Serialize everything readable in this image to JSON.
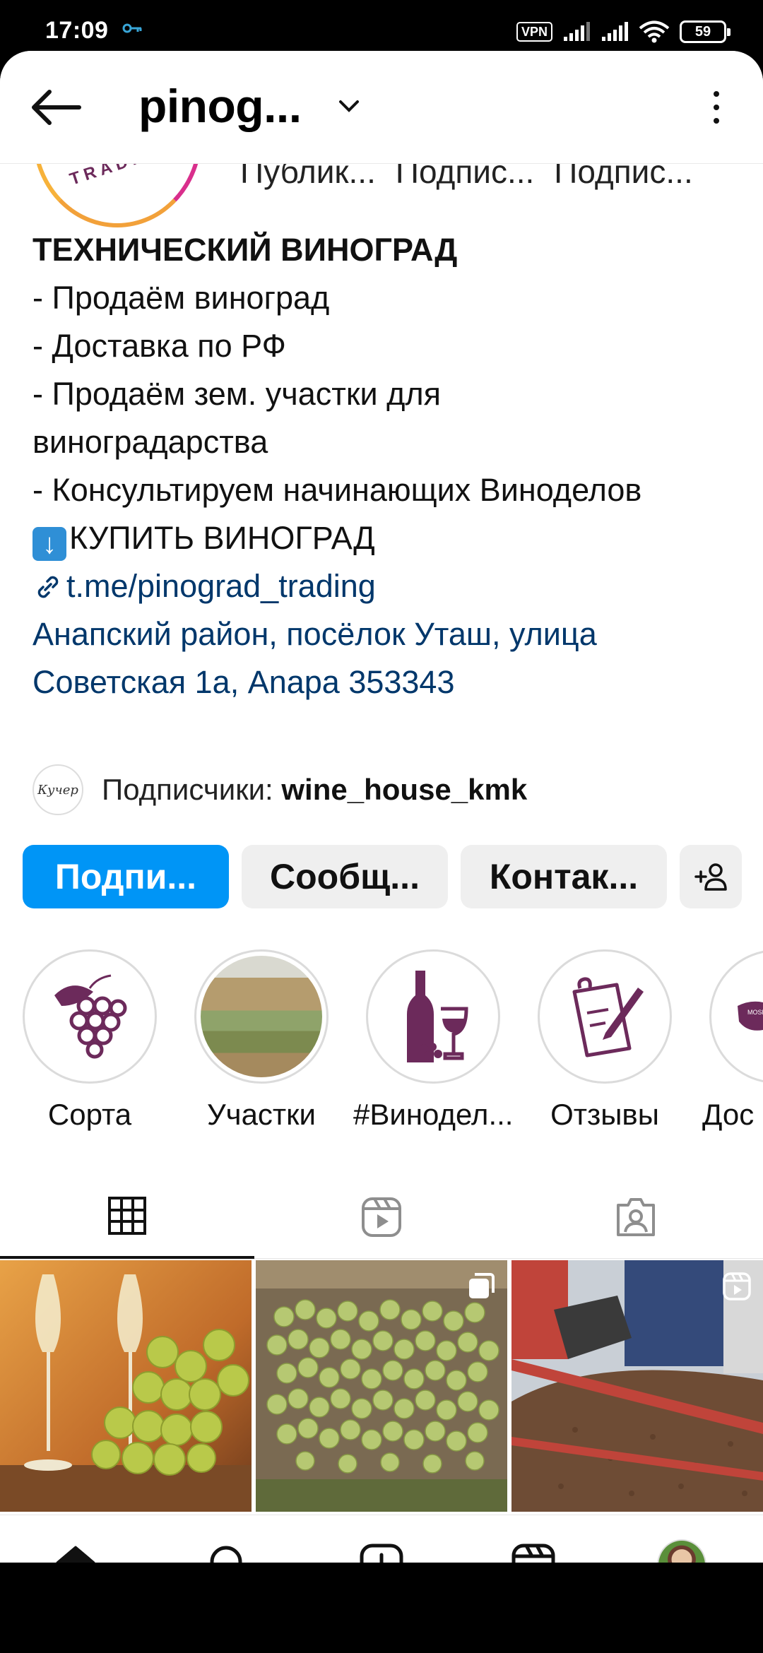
{
  "status_bar": {
    "time": "17:09",
    "vpn_label": "VPN",
    "battery_level": "59",
    "icons": [
      "key-icon",
      "vpn-icon",
      "signal-icon",
      "signal-icon",
      "wifi-icon",
      "battery-icon"
    ]
  },
  "header": {
    "username": "pinog...",
    "icons": [
      "back-arrow-icon",
      "chevron-down-icon",
      "more-vertical-icon"
    ]
  },
  "profile": {
    "avatar_text": "TRADING",
    "stats": [
      "Публик...",
      "Подпис...",
      "Подпис..."
    ],
    "bio": {
      "title": "ТЕХНИЧЕСКИЙ ВИНОГРАД",
      "line1": "- Продаём виноград",
      "line2": "- Доставка по РФ",
      "line3": "- Продаём зем. участки для виноградарства",
      "line4": "- Консультируем начинающих Виноделов",
      "cta": "КУПИТЬ ВИНОГРАД",
      "link": "t.me/pinograd_trading",
      "address": "Анапский район, посёлок Уташ, улица Советская 1а, Anapa 353343"
    },
    "followed_by_prefix": "Подписчики:",
    "followed_by_user": "wine_house_kmk",
    "followed_by_avatar_text": "Кучер"
  },
  "buttons": {
    "follow": "Подпи...",
    "message": "Сообщ...",
    "contact": "Контак...",
    "add_user_icon": "add-user-icon"
  },
  "highlights": [
    {
      "label": "Сорта",
      "icon": "grapes-icon"
    },
    {
      "label": "Участки",
      "icon": "vineyard-photo"
    },
    {
      "label": "#Винодел...",
      "icon": "wine-bottle-icon"
    },
    {
      "label": "Отзывы",
      "icon": "notepad-icon"
    },
    {
      "label": "Дос",
      "icon": "russia-map-icon"
    }
  ],
  "tabs": [
    {
      "name": "grid",
      "icon": "grid-icon",
      "active": true
    },
    {
      "name": "reels",
      "icon": "reels-icon",
      "active": false
    },
    {
      "name": "tagged",
      "icon": "tagged-icon",
      "active": false
    }
  ],
  "posts": [
    {
      "content": "wine glasses with white grapes",
      "badge": ""
    },
    {
      "content": "white grape clusters",
      "badge": "carousel-icon"
    },
    {
      "content": "grape pomace unloading",
      "badge": "reels-icon"
    }
  ],
  "bottom_nav": [
    "home-icon",
    "search-icon",
    "new-post-icon",
    "reels-icon",
    "profile-avatar"
  ],
  "system_nav": [
    "recent-apps-icon",
    "home-circle-icon",
    "back-triangle-icon"
  ],
  "colors": {
    "accent": "#0095f6",
    "link": "#00376b",
    "brand_purple": "#6c2a5b"
  }
}
